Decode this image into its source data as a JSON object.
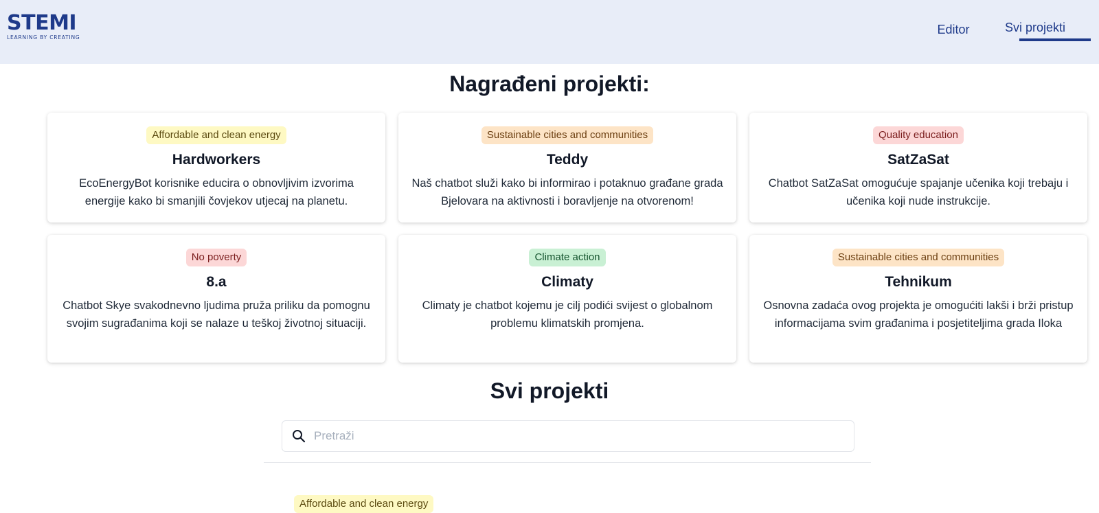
{
  "header": {
    "logo": {
      "main": "STEMI",
      "tagline": "LEARNING BY CREATING"
    },
    "nav": [
      {
        "label": "Editor"
      },
      {
        "label": "Svi projekti"
      }
    ]
  },
  "awarded": {
    "heading": "Nagrađeni projekti:",
    "cards": [
      {
        "tag": "Affordable and clean energy",
        "title": "Hardworkers",
        "description": "EcoEnergyBot korisnike educira o obnovljivim izvorima energije kako bi smanjili čovjekov utjecaj na planetu."
      },
      {
        "tag": "Sustainable cities and communities",
        "title": "Teddy",
        "description": "Naš chatbot služi kako bi informirao i potaknuo građane grada Bjelovara na aktivnosti i boravljenje na otvorenom!"
      },
      {
        "tag": "Quality education",
        "title": "SatZaSat",
        "description": "Chatbot SatZaSat omogućuje spajanje učenika koji trebaju i učenika koji nude instrukcije."
      },
      {
        "tag": "No poverty",
        "title": "8.a",
        "description": "Chatbot Skye svakodnevno ljudima pruža priliku da pomognu svojim sugrađanima koji se nalaze u teškoj životnoj situaciji."
      },
      {
        "tag": "Climate action",
        "title": "Climaty",
        "description": "Climaty je chatbot kojemu je cilj podići svijest o globalnom problemu klimatskih promjena."
      },
      {
        "tag": "Sustainable cities and communities",
        "title": "Tehnikum",
        "description": "Osnovna zadaća ovog projekta je omogućiti lakši i brži pristup informacijama svim građanima i posjetiteljima grada Iloka"
      }
    ]
  },
  "all_projects": {
    "heading": "Svi projekti",
    "search": {
      "placeholder": "Pretraži",
      "value": ""
    },
    "first_item_tag": "Affordable and clean energy"
  },
  "colors": {
    "brand": "#1e3a8a",
    "header_bg": "#e8edf8",
    "tag_yellow": "#fef9c3",
    "tag_orange": "#fde4c6",
    "tag_red": "#fcd7d7",
    "tag_green": "#c9f0d4"
  },
  "icons": {
    "search": "search-icon"
  }
}
